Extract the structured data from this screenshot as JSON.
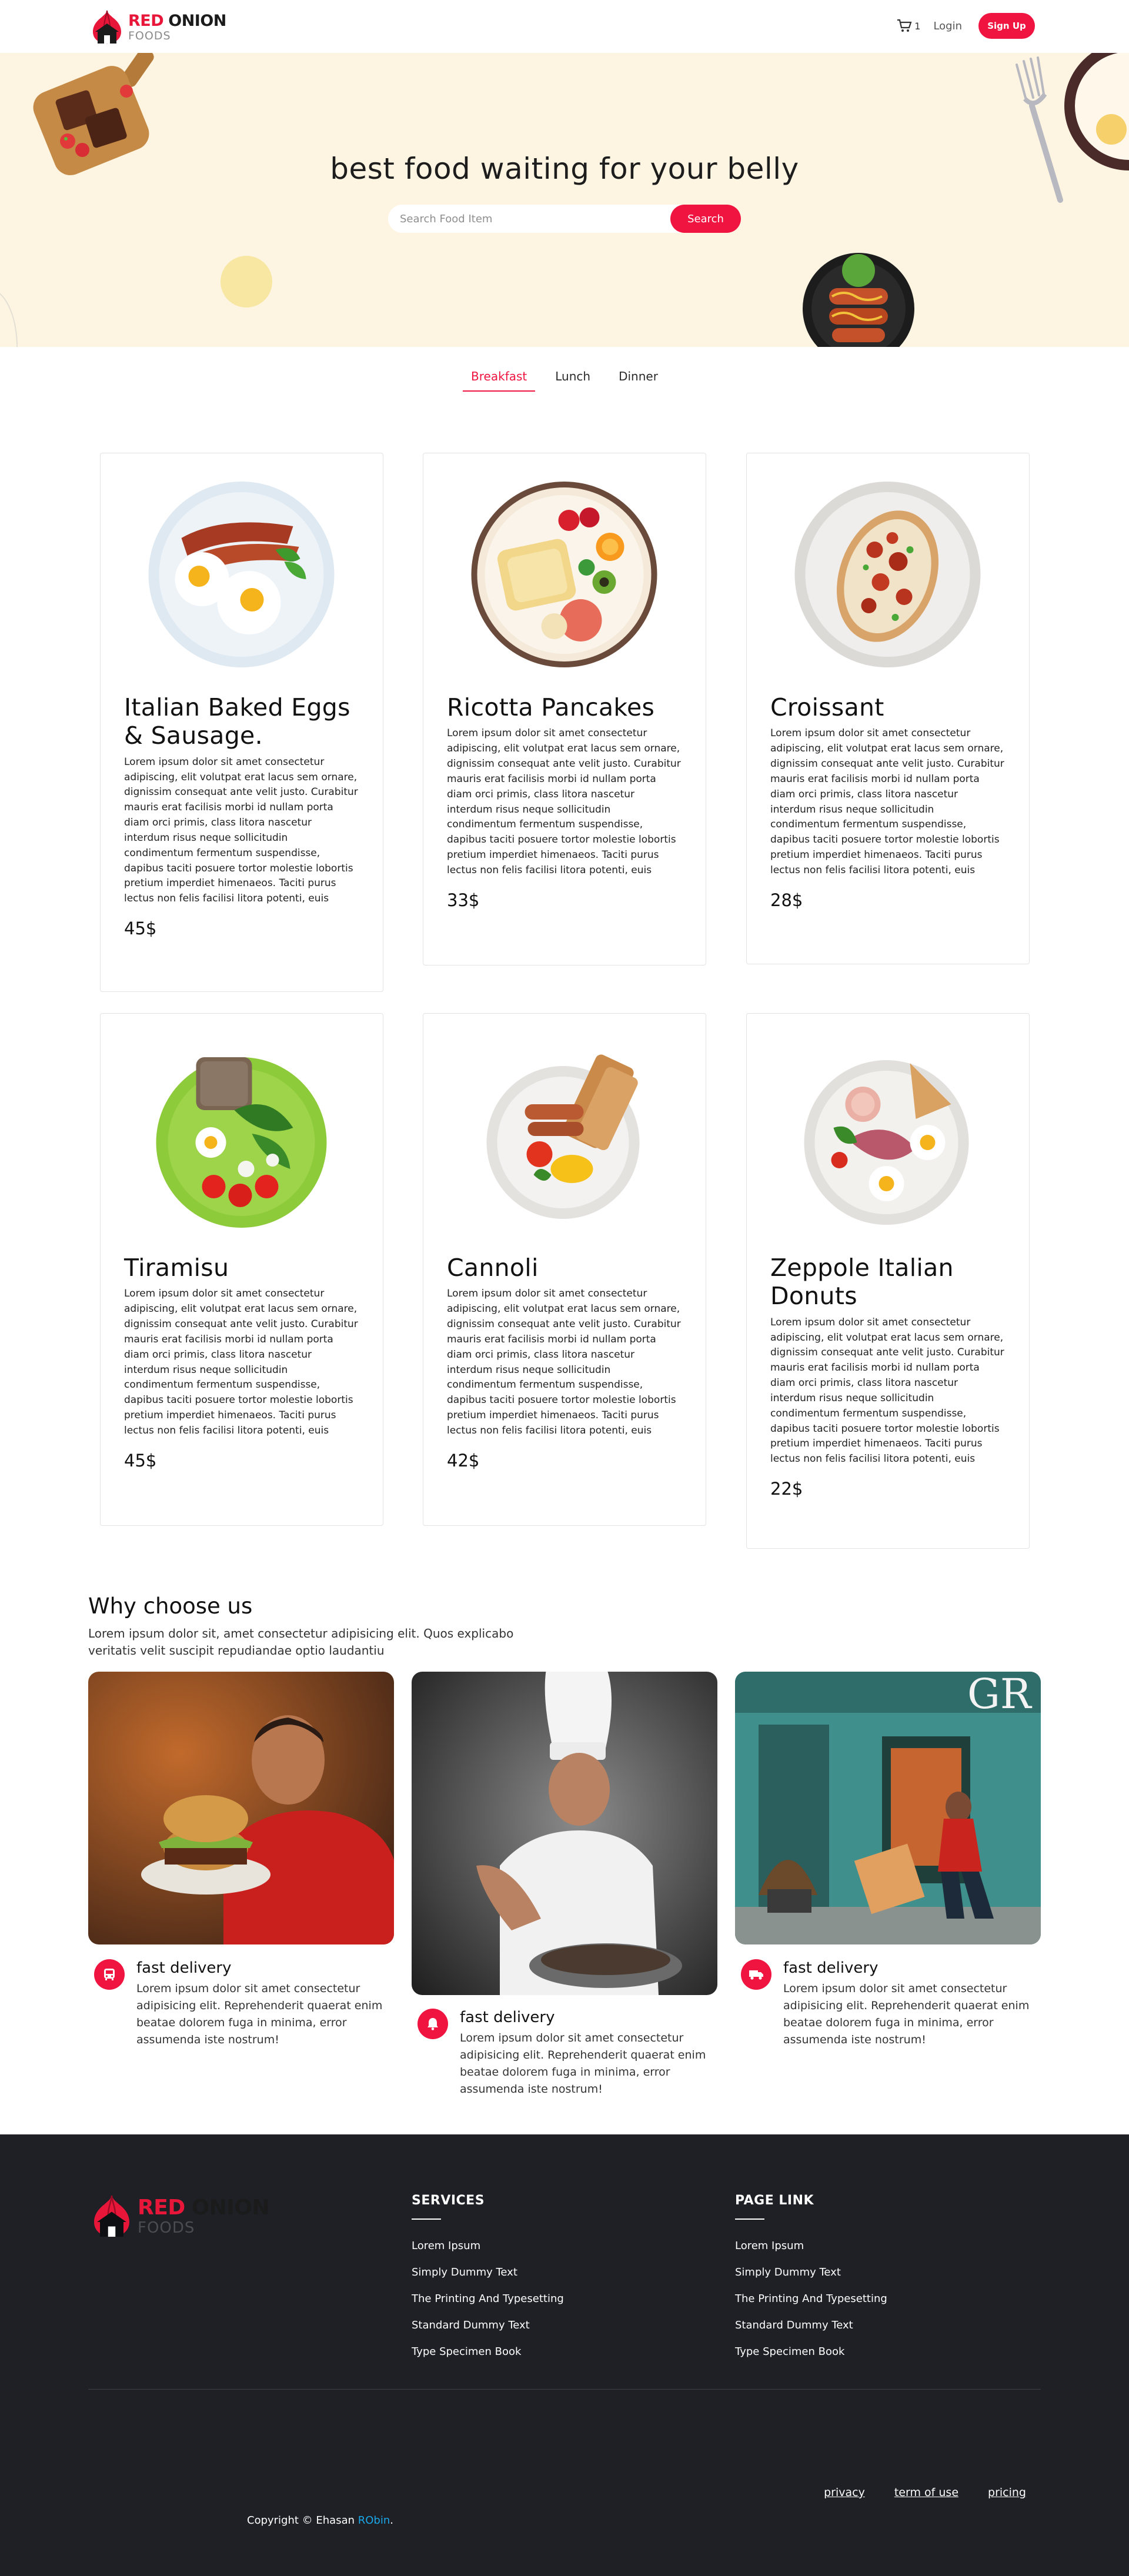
{
  "brand": {
    "name_red": "RED",
    "name_dark": "ONION",
    "sub": "FOODS"
  },
  "nav": {
    "cart_count": "1",
    "login": "Login",
    "signup": "Sign Up"
  },
  "hero": {
    "title": "best food waiting for your belly",
    "search_placeholder": "Search Food Item",
    "search_button": "Search"
  },
  "tabs": [
    {
      "label": "Breakfast",
      "active": true
    },
    {
      "label": "Lunch",
      "active": false
    },
    {
      "label": "Dinner",
      "active": false
    }
  ],
  "cards": [
    {
      "title": "Italian Baked Eggs & Sausage.",
      "desc": "Lorem ipsum dolor sit amet consectetur adipiscing, elit volutpat erat lacus sem ornare, dignissim consequat ante velit justo. Curabitur mauris erat facilisis morbi id nullam porta diam orci primis, class litora nascetur interdum risus neque sollicitudin condimentum fermentum suspendisse, dapibus taciti posuere tortor molestie lobortis pretium imperdiet himenaeos. Taciti purus lectus non felis facilisi litora potenti, euis",
      "price": "45$",
      "plate": "eggs-bacon"
    },
    {
      "title": "Ricotta Pancakes",
      "desc": "Lorem ipsum dolor sit amet consectetur adipiscing, elit volutpat erat lacus sem ornare, dignissim consequat ante velit justo. Curabitur mauris erat facilisis morbi id nullam porta diam orci primis, class litora nascetur interdum risus neque sollicitudin condimentum fermentum suspendisse, dapibus taciti posuere tortor molestie lobortis pretium imperdiet himenaeos. Taciti purus lectus non felis facilisi litora potenti, euis",
      "price": "33$",
      "plate": "fruit-toast"
    },
    {
      "title": "Croissant",
      "desc": "Lorem ipsum dolor sit amet consectetur adipiscing, elit volutpat erat lacus sem ornare, dignissim consequat ante velit justo. Curabitur mauris erat facilisis morbi id nullam porta diam orci primis, class litora nascetur interdum risus neque sollicitudin condimentum fermentum suspendisse, dapibus taciti posuere tortor molestie lobortis pretium imperdiet himenaeos. Taciti purus lectus non felis facilisi litora potenti, euis",
      "price": "28$",
      "plate": "bacon-toast"
    },
    {
      "title": "Tiramisu",
      "desc": "Lorem ipsum dolor sit amet consectetur adipiscing, elit volutpat erat lacus sem ornare, dignissim consequat ante velit justo. Curabitur mauris erat facilisis morbi id nullam porta diam orci primis, class litora nascetur interdum risus neque sollicitudin condimentum fermentum suspendisse, dapibus taciti posuere tortor molestie lobortis pretium imperdiet himenaeos. Taciti purus lectus non felis facilisi litora potenti, euis",
      "price": "45$",
      "plate": "green-salad"
    },
    {
      "title": "Cannoli",
      "desc": "Lorem ipsum dolor sit amet consectetur adipiscing, elit volutpat erat lacus sem ornare, dignissim consequat ante velit justo. Curabitur mauris erat facilisis morbi id nullam porta diam orci primis, class litora nascetur interdum risus neque sollicitudin condimentum fermentum suspendisse, dapibus taciti posuere tortor molestie lobortis pretium imperdiet himenaeos. Taciti purus lectus non felis facilisi litora potenti, euis",
      "price": "42$",
      "plate": "toast-sausage"
    },
    {
      "title": "Zeppole Italian Donuts",
      "desc": "Lorem ipsum dolor sit amet consectetur adipiscing, elit volutpat erat lacus sem ornare, dignissim consequat ante velit justo. Curabitur mauris erat facilisis morbi id nullam porta diam orci primis, class litora nascetur interdum risus neque sollicitudin condimentum fermentum suspendisse, dapibus taciti posuere tortor molestie lobortis pretium imperdiet himenaeos. Taciti purus lectus non felis facilisi litora potenti, euis",
      "price": "22$",
      "plate": "ham-eggs"
    }
  ],
  "why": {
    "title": "Why choose us",
    "subtitle": "Lorem ipsum dolor sit, amet consectetur adipisicing elit. Quos explicabo veritatis velit suscipit repudiandae optio laudantiu",
    "features": [
      {
        "title": "fast delivery",
        "desc": "Lorem ipsum dolor sit amet consectetur adipisicing elit. Reprehenderit quaerat enim beatae dolorem fuga in minima, error assumenda iste nostrum!",
        "icon": "bus-icon"
      },
      {
        "title": "fast delivery",
        "desc": "Lorem ipsum dolor sit amet consectetur adipisicing elit. Reprehenderit quaerat enim beatae dolorem fuga in minima, error assumenda iste nostrum!",
        "icon": "bell-icon"
      },
      {
        "title": "fast delivery",
        "desc": "Lorem ipsum dolor sit amet consectetur adipisicing elit. Reprehenderit quaerat enim beatae dolorem fuga in minima, error assumenda iste nostrum!",
        "icon": "truck-icon"
      }
    ]
  },
  "footer": {
    "services_title": "SERVICES",
    "services": [
      "Lorem Ipsum",
      "Simply Dummy Text",
      "The Printing And Typesetting",
      "Standard Dummy Text",
      "Type Specimen Book"
    ],
    "pagelink_title": "PAGE LINK",
    "pagelinks": [
      "Lorem Ipsum",
      "Simply Dummy Text",
      "The Printing And Typesetting",
      "Standard Dummy Text",
      "Type Specimen Book"
    ],
    "legal": [
      "privacy",
      "term of use",
      "pricing"
    ],
    "copyright_prefix": "Copyright © Ehasan ",
    "copyright_name": "RObin",
    "copyright_suffix": "."
  },
  "colors": {
    "accent": "#f01440",
    "hero_bg": "#fdf5e2",
    "footer_bg": "#1e2026",
    "link_blue": "#1aa7e8"
  }
}
